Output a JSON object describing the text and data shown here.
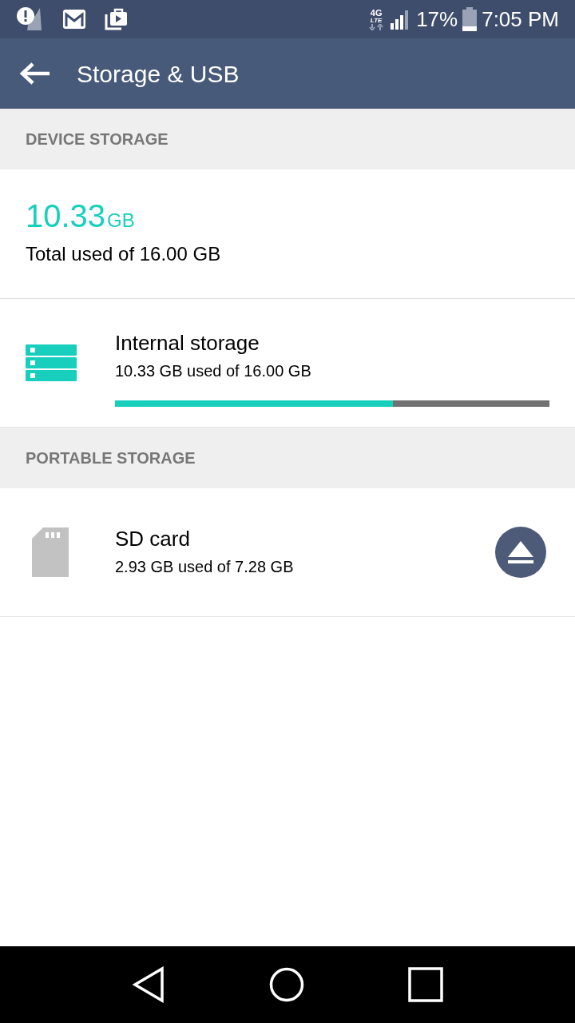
{
  "status_bar": {
    "network_top": "4G",
    "network_bottom": "LTE",
    "battery": "17%",
    "time": "7:05 PM"
  },
  "toolbar": {
    "title": "Storage & USB"
  },
  "sections": [
    {
      "header": "DEVICE STORAGE",
      "summary": {
        "amount": "10.33",
        "unit": "GB",
        "caption": "Total used of 16.00 GB"
      },
      "items": [
        {
          "kind": "internal",
          "title": "Internal storage",
          "subtitle": "10.33 GB used of 16.00 GB",
          "level": 0.64
        }
      ]
    },
    {
      "header": "PORTABLE STORAGE",
      "items": [
        {
          "kind": "sd",
          "title": "SD card",
          "subtitle": "2.93 GB used of 7.28 GB",
          "ejectable": true
        }
      ]
    }
  ]
}
